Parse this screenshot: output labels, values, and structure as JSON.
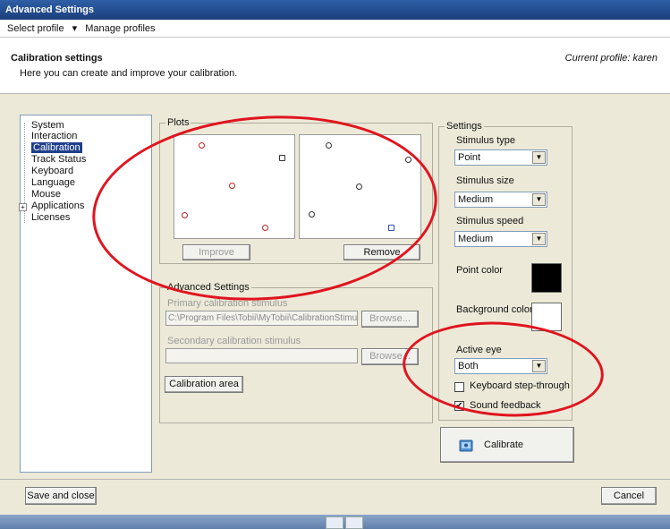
{
  "window": {
    "title": "Advanced Settings"
  },
  "menu": {
    "select_profile": "Select profile",
    "arrow": "▾",
    "manage_profiles": "Manage profiles"
  },
  "header": {
    "title": "Calibration settings",
    "subtitle": "Here you can create and improve your calibration.",
    "current_profile": "Current profile: karen"
  },
  "tree": {
    "items": [
      "System",
      "Interaction",
      "Calibration",
      "Track Status",
      "Keyboard",
      "Language",
      "Mouse",
      "Applications",
      "Licenses"
    ],
    "selected": "Calibration",
    "expander": "+"
  },
  "plots": {
    "legend": "Plots",
    "improve_label": "Improve",
    "remove_label": "Remove"
  },
  "advanced": {
    "legend": "Advanced Settings",
    "primary_label": "Primary calibration stimulus",
    "primary_value": "C:\\Program Files\\Tobii\\MyTobii\\CalibrationStimuli\\",
    "secondary_label": "Secondary calibration stimulus",
    "secondary_value": "",
    "browse_label": "Browse...",
    "calibration_area_label": "Calibration area"
  },
  "settings": {
    "legend": "Settings",
    "stimulus_type_label": "Stimulus type",
    "stimulus_type_value": "Point",
    "stimulus_size_label": "Stimulus size",
    "stimulus_size_value": "Medium",
    "stimulus_speed_label": "Stimulus speed",
    "stimulus_speed_value": "Medium",
    "point_color_label": "Point color",
    "point_color": "#000000",
    "background_color_label": "Background color",
    "background_color": "#ffffff",
    "active_eye_label": "Active eye",
    "active_eye_value": "Both",
    "keyboard_step_label": "Keyboard step-through",
    "keyboard_step_checked": false,
    "sound_feedback_label": "Sound feedback",
    "sound_feedback_checked": true,
    "dropdown_arrow": "▼",
    "check_mark": "✔",
    "calibrate_label": "Calibrate"
  },
  "footer": {
    "save_label": "Save and close",
    "cancel_label": "Cancel"
  },
  "annotation_color": "#e0141e",
  "edge_glyph": "t"
}
